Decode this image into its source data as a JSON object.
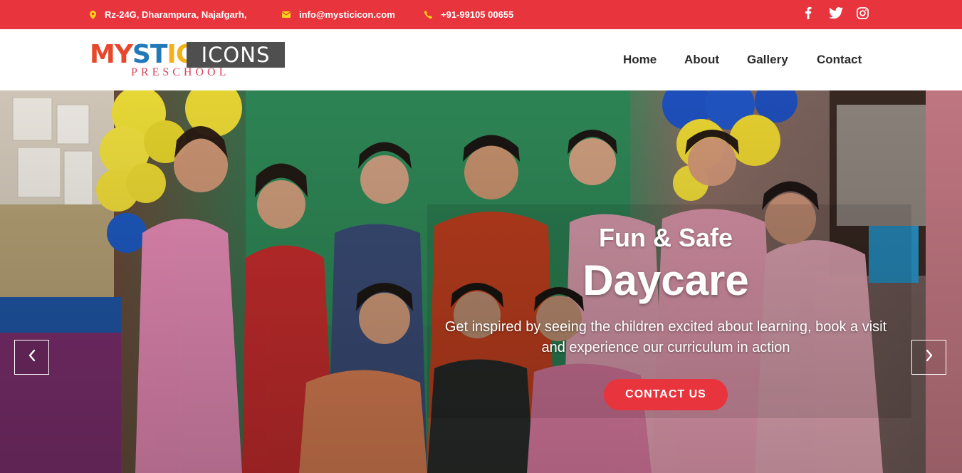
{
  "topbar": {
    "address": "Rz-24G, Dharampura, Najafgarh,",
    "email": "info@mysticicon.com",
    "phone": "+91-99105 00655",
    "icons": {
      "address": "map-pin-icon",
      "email": "envelope-icon",
      "phone": "phone-icon",
      "social": [
        "facebook-icon",
        "twitter-icon",
        "instagram-icon"
      ]
    }
  },
  "brand": {
    "logo_letters": [
      "M",
      "Y",
      "S",
      "T",
      "I",
      "C"
    ],
    "logo_second": "ICONS",
    "logo_sub": "PRESCHOOL"
  },
  "nav": {
    "items": [
      {
        "label": "Home"
      },
      {
        "label": "About"
      },
      {
        "label": "Gallery"
      },
      {
        "label": "Contact"
      }
    ]
  },
  "hero": {
    "kicker": "Fun & Safe",
    "title": "Daycare",
    "description": "Get inspired by seeing the children excited about learning, book a visit and experience our curriculum in action",
    "cta_label": "CONTACT US",
    "prev_icon": "chevron-left-icon",
    "next_icon": "chevron-right-icon"
  },
  "colors": {
    "accent": "#e8343c",
    "topbar_icon": "#ffd21a",
    "logo_box": "#4f4f4f",
    "nav_text": "#2b2b2b"
  }
}
